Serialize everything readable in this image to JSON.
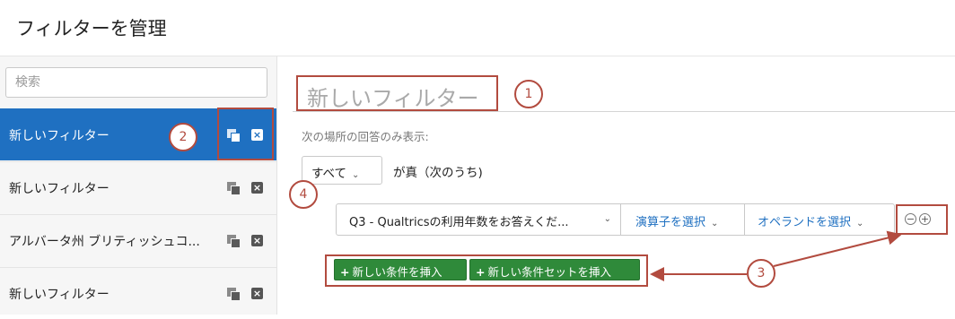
{
  "page": {
    "title": "フィルターを管理"
  },
  "sidebar": {
    "search_placeholder": "検索",
    "items": [
      {
        "label": "新しいフィルター",
        "active": true
      },
      {
        "label": "新しいフィルター",
        "active": false
      },
      {
        "label": "アルバータ州 ブリティッシュコ...",
        "active": false
      },
      {
        "label": "新しいフィルター",
        "active": false
      }
    ],
    "copy_icon": "copy-icon",
    "delete_icon": "close-icon"
  },
  "editor": {
    "filter_name": "新しいフィルター",
    "only_show_label": "次の場所の回答のみ表示:",
    "match_dropdown": "すべて",
    "true_of_text": "が真（次のうち)",
    "condition": {
      "question": "Q3 - Qualtricsの利用年数をお答えくだ...",
      "operator": "演算子を選択",
      "operand": "オペランドを選択"
    },
    "remove_symbol": "−",
    "add_symbol": "+",
    "insert_condition": "新しい条件を挿入",
    "insert_condition_set": "新しい条件セットを挿入"
  },
  "callouts": [
    "1",
    "2",
    "3",
    "4"
  ],
  "colors": {
    "accent": "#1f70c1",
    "green": "#2f8a3a",
    "callout": "#b24b3f"
  }
}
